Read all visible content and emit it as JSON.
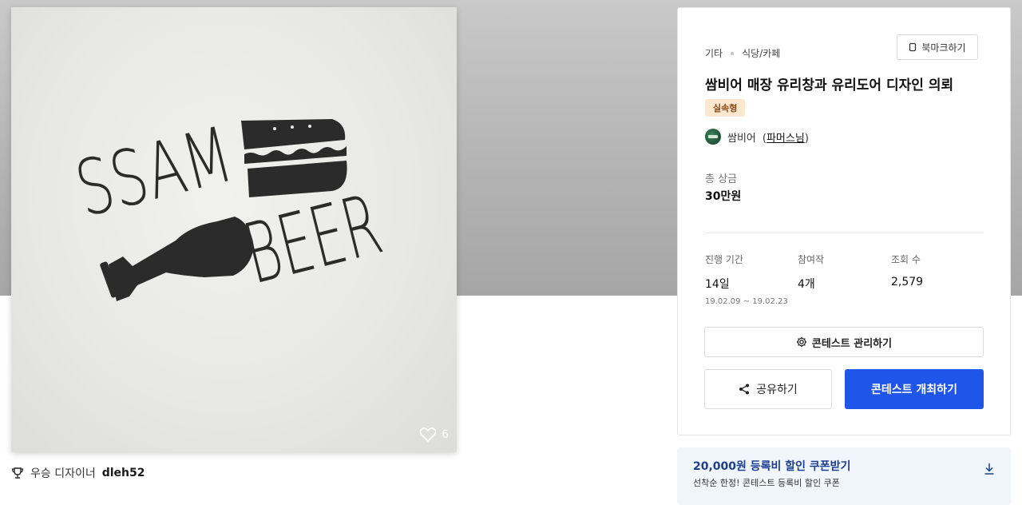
{
  "artwork": {
    "logo_line1": "SSAM",
    "logo_line2": "BEER",
    "like_count": "6",
    "winner_label": "우승 디자이너",
    "winner_name": "dleh52"
  },
  "contest": {
    "category_main": "기타",
    "category_sub": "식당/카페",
    "bookmark_label": "북마크하기",
    "title": "쌈비어 매장 유리창과 유리도어 디자인 의뢰",
    "badge": "실속형",
    "host_name": "쌈비어",
    "host_grade": "파머스님",
    "prize_label": "총 상금",
    "prize_value": "30만원",
    "stats": [
      {
        "label": "진행 기간",
        "value": "14일",
        "sub": "19.02.09 ~ 19.02.23"
      },
      {
        "label": "참여작",
        "value": "4개"
      },
      {
        "label": "조회 수",
        "value": "2,579"
      }
    ],
    "manage_label": "콘테스트 관리하기",
    "share_label": "공유하기",
    "open_label": "콘테스트 개최하기"
  },
  "coupon": {
    "title": "20,000원 등록비 할인 쿠폰받기",
    "subtitle": "선착순 한정! 콘테스트 등록비 할인 쿠폰"
  },
  "colors": {
    "primary": "#1f55e8",
    "badge_bg": "#fde7cf",
    "coupon_bg": "#f1f5fc",
    "coupon_text": "#1c3f91"
  }
}
